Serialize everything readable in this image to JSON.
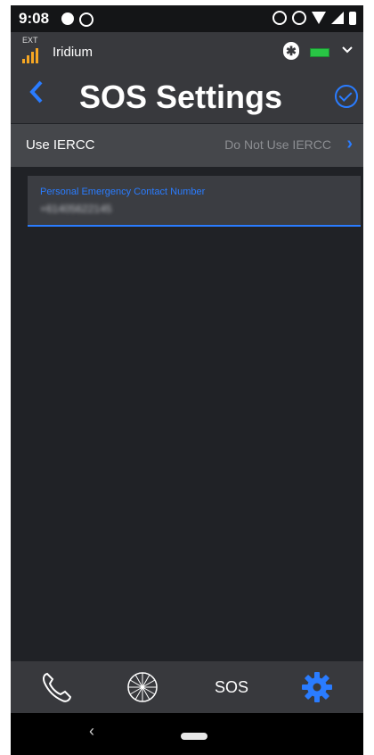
{
  "status_bar": {
    "time": "9:08"
  },
  "connection": {
    "ext": "EXT",
    "carrier": "Iridium",
    "bluetooth": "✱"
  },
  "header": {
    "title": "SOS Settings"
  },
  "settings_row": {
    "label": "Use IERCC",
    "value": "Do Not Use IERCC",
    "arrow": "›"
  },
  "contact_field": {
    "label": "Personal Emergency Contact Number",
    "value": "+61405622145"
  },
  "tabbar": {
    "tabs": [
      {
        "icon": "phone-icon"
      },
      {
        "icon": "globe-icon"
      },
      {
        "label": "SOS"
      },
      {
        "icon": "gear-icon",
        "active": true
      }
    ],
    "active_color": "#2a7cff"
  },
  "navbar": {
    "back": "‹"
  },
  "colors": {
    "accent": "#2a7cff",
    "background": "#202226",
    "header": "#38393d"
  }
}
